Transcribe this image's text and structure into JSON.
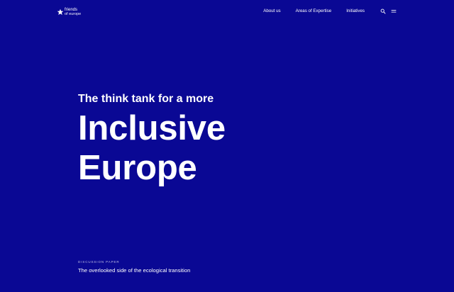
{
  "brand": {
    "logo_line_1": "friends",
    "logo_line_2": "of europe",
    "background_color": "#0a0894",
    "text_color": "#ffffff"
  },
  "header": {
    "nav_items": [
      {
        "label": "About us"
      },
      {
        "label": "Areas of Expertise"
      },
      {
        "label": "Initiatives"
      }
    ],
    "icons": [
      "search-icon",
      "menu-icon"
    ]
  },
  "hero": {
    "kicker": "The think tank for a more",
    "title_line_1": "Inclusive",
    "title_line_2": "Europe"
  },
  "feature": {
    "label": "DISCUSSION PAPER",
    "title": "The overlooked side of the ecological transition"
  }
}
